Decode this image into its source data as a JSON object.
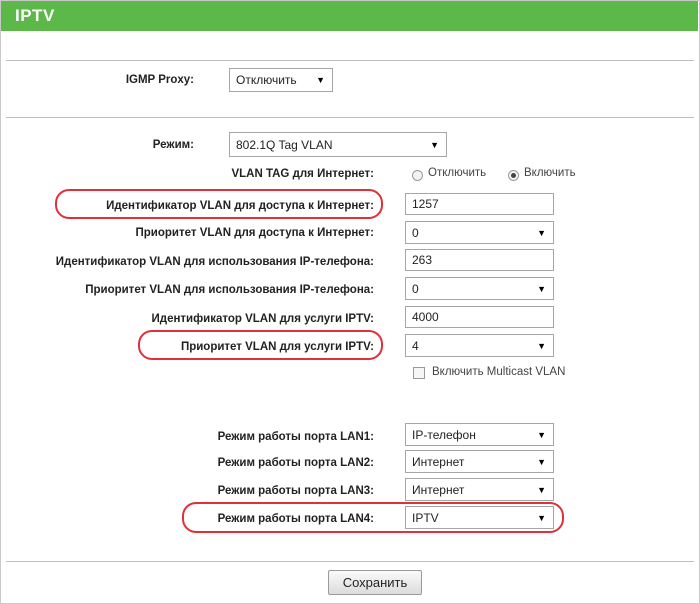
{
  "header": {
    "title": "IPTV"
  },
  "igmp": {
    "label": "IGMP Proxy:",
    "value": "Отключить"
  },
  "mode": {
    "label": "Режим:",
    "value": "802.1Q Tag VLAN"
  },
  "vlan_tag": {
    "label": "VLAN TAG для Интернет:",
    "option_off": "Отключить",
    "option_on": "Включить",
    "selected": "Включить"
  },
  "internet_vlan_id": {
    "label": "Идентификатор VLAN для доступа к Интернет:",
    "value": "1257"
  },
  "internet_vlan_priority": {
    "label": "Приоритет VLAN для доступа к Интернет:",
    "value": "0"
  },
  "phone_vlan_id": {
    "label": "Идентификатор VLAN для использования IP-телефона:",
    "value": "263"
  },
  "phone_vlan_priority": {
    "label": "Приоритет VLAN для использования IP-телефона:",
    "value": "0"
  },
  "iptv_vlan_id": {
    "label": "Идентификатор VLAN для услуги IPTV:",
    "value": "4000"
  },
  "iptv_vlan_priority": {
    "label": "Приоритет VLAN для услуги IPTV:",
    "value": "4"
  },
  "multicast": {
    "label": "Включить Multicast VLAN",
    "checked": false
  },
  "lan_ports": [
    {
      "label": "Режим работы порта LAN1:",
      "value": "IP-телефон"
    },
    {
      "label": "Режим работы порта LAN2:",
      "value": "Интернет"
    },
    {
      "label": "Режим работы порта LAN3:",
      "value": "Интернет"
    },
    {
      "label": "Режим работы порта LAN4:",
      "value": "IPTV"
    }
  ],
  "save_label": "Сохранить",
  "colors": {
    "header": "#5db84a",
    "highlight": "#e0303a"
  }
}
